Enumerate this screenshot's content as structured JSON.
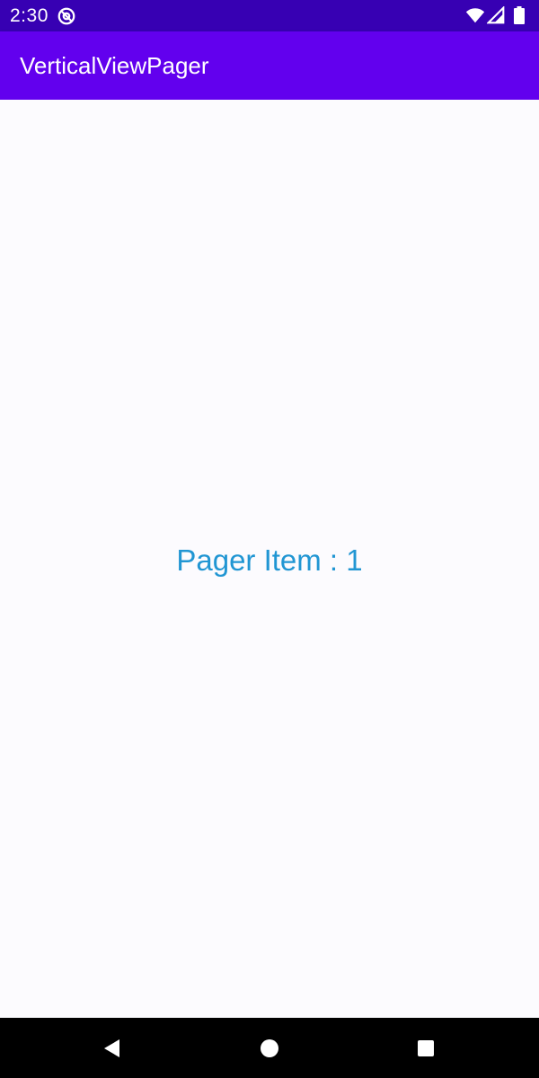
{
  "status_bar": {
    "time": "2:30",
    "notification_icon": "at-sign-icon",
    "icons": [
      "wifi-icon",
      "signal-icon",
      "battery-icon"
    ],
    "background": "#3700b3"
  },
  "app_bar": {
    "title": "VerticalViewPager",
    "background": "#6200ee"
  },
  "pager": {
    "item_text": "Pager Item : 1",
    "text_color": "#2196d3"
  },
  "nav_bar": {
    "buttons": [
      "back-icon",
      "home-icon",
      "recents-icon"
    ]
  }
}
